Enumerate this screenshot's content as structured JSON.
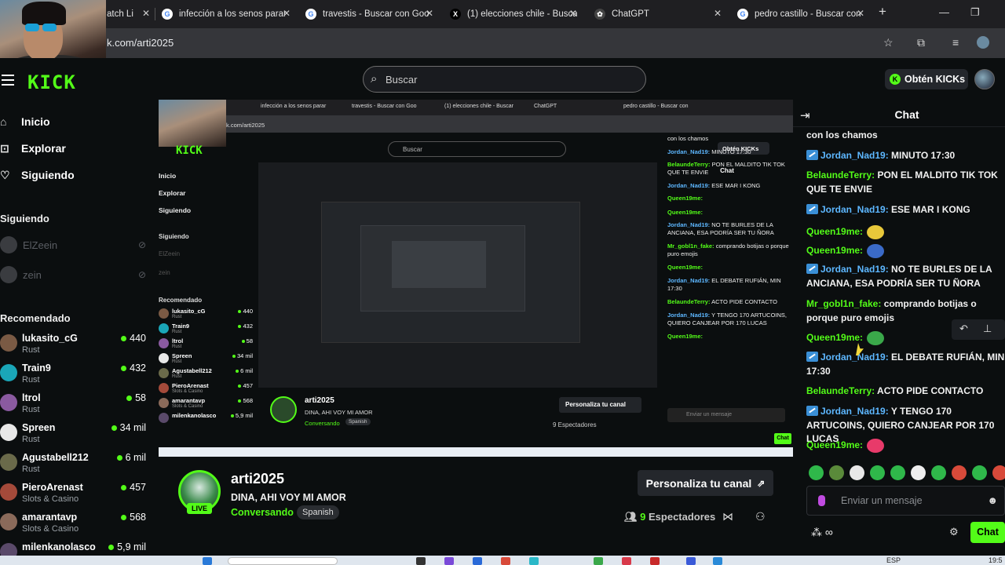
{
  "browser": {
    "tabs": [
      {
        "label": "atch Li",
        "icon": "twitch-icon"
      },
      {
        "label": "infección a los senos parar",
        "icon": "google-icon"
      },
      {
        "label": "travestis - Buscar con Goo",
        "icon": "google-icon"
      },
      {
        "label": "(1) elecciones chile - Buscar",
        "icon": "x-icon"
      },
      {
        "label": "ChatGPT",
        "icon": "chatgpt-icon"
      },
      {
        "label": "pedro castillo - Buscar con",
        "icon": "google-icon"
      }
    ],
    "url": "k.com/arti2025"
  },
  "header": {
    "logo": "KICK",
    "search_placeholder": "Buscar",
    "kicks_button": "Obtén KICKs"
  },
  "sidebar": {
    "nav": [
      {
        "label": "Inicio",
        "icon": "home-icon"
      },
      {
        "label": "Explorar",
        "icon": "compass-icon"
      },
      {
        "label": "Siguiendo",
        "icon": "heart-icon"
      }
    ],
    "following_title": "Siguiendo",
    "following": [
      {
        "name": "ElZeein"
      },
      {
        "name": "zein"
      }
    ],
    "recommended_title": "Recomendado",
    "recommended": [
      {
        "name": "lukasito_cG",
        "category": "Rust",
        "viewers": "440",
        "color": "#7a5a44"
      },
      {
        "name": "Train9",
        "category": "Rust",
        "viewers": "432",
        "color": "#1aa6b8"
      },
      {
        "name": "ltrol",
        "category": "Rust",
        "viewers": "58",
        "color": "#8a5aa0"
      },
      {
        "name": "Spreen",
        "category": "Rust",
        "viewers": "34 mil",
        "color": "#e8e8e8"
      },
      {
        "name": "Agustabell212",
        "category": "Rust",
        "viewers": "6 mil",
        "color": "#6a6a4a"
      },
      {
        "name": "PieroArenast",
        "category": "Slots & Casino",
        "viewers": "457",
        "color": "#a44a3a"
      },
      {
        "name": "amarantavp",
        "category": "Slots & Casino",
        "viewers": "568",
        "color": "#8a6a5a"
      },
      {
        "name": "milenkanolasco",
        "category": "",
        "viewers": "5,9 mil",
        "color": "#5a4a6a"
      }
    ]
  },
  "video_inner": {
    "url": "k.com/arti2025",
    "search_placeholder": "Buscar",
    "kicks_button": "Obtén KICKs",
    "nav": [
      "Inicio",
      "Explorar",
      "Siguiendo"
    ],
    "following_title": "Siguiendo",
    "following": [
      "ElZeein",
      "zein"
    ],
    "recommended_title": "Recomendado",
    "recommended": [
      {
        "name": "lukasito_cG",
        "category": "Rust",
        "viewers": "440"
      },
      {
        "name": "Train9",
        "category": "Rust",
        "viewers": "432"
      },
      {
        "name": "ltrol",
        "category": "Rust",
        "viewers": "58"
      },
      {
        "name": "Spreen",
        "category": "Rust",
        "viewers": "34 mil"
      },
      {
        "name": "Agustabell212",
        "category": "Rust",
        "viewers": "6 mil"
      },
      {
        "name": "PieroArenast",
        "category": "Slots & Casino",
        "viewers": "457"
      },
      {
        "name": "amarantavp",
        "category": "Slots & Casino",
        "viewers": "568"
      },
      {
        "name": "milenkanolasco",
        "category": "",
        "viewers": "5,9 mil"
      }
    ],
    "chat_title": "Chat",
    "chat_messages": [
      {
        "user": "",
        "text": "con los chamos"
      },
      {
        "user": "Jordan_Nad19:",
        "text": "MINUTO 17:30",
        "blue": true
      },
      {
        "user": "BelaundeTerry:",
        "text": "PON EL MALDITO TIK TOK QUE TE ENVIE"
      },
      {
        "user": "Jordan_Nad19:",
        "text": "ESE MAR I KONG",
        "blue": true
      },
      {
        "user": "Queen19me:",
        "text": ""
      },
      {
        "user": "Queen19me:",
        "text": ""
      },
      {
        "user": "Jordan_Nad19:",
        "text": "NO TE BURLES DE LA ANCIANA, ESA PODRÍA SER TU ÑORA",
        "blue": true
      },
      {
        "user": "Mr_gobl1n_fake:",
        "text": "comprando botijas o porque puro emojis"
      },
      {
        "user": "Queen19me:",
        "text": ""
      },
      {
        "user": "Jordan_Nad19:",
        "text": "EL DEBATE RUFIÁN, MIN 17:30",
        "blue": true
      },
      {
        "user": "BelaundeTerry:",
        "text": "ACTO PIDE CONTACTO"
      },
      {
        "user": "Jordan_Nad19:",
        "text": "Y TENGO 170 ARTUCOINS, QUIERO CANJEAR POR 170 LUCAS",
        "blue": true
      },
      {
        "user": "Queen19me:",
        "text": ""
      }
    ],
    "chat_placeholder": "Enviar un mensaje",
    "chat_send": "Chat",
    "streamer": "arti2025",
    "title": "DINA, AHI VOY MI AMOR",
    "category": "Conversando",
    "tag": "Spanish",
    "personalize": "Personaliza tu canal",
    "viewers": "9 Espectadores"
  },
  "stream": {
    "streamer": "arti2025",
    "live_label": "LIVE",
    "title": "DINA, AHI VOY MI AMOR",
    "category": "Conversando",
    "tag": "Spanish",
    "personalize": "Personaliza tu canal",
    "viewer_count": "9",
    "viewer_label": "Espectadores"
  },
  "chat": {
    "title": "Chat",
    "messages": [
      {
        "user": "",
        "text": "con los chamos",
        "blue": false,
        "badge": false
      },
      {
        "user": "Jordan_Nad19:",
        "text": "MINUTO 17:30",
        "blue": true,
        "badge": true
      },
      {
        "user": "BelaundeTerry:",
        "text": "PON EL MALDITO TIK TOK QUE TE ENVIE",
        "blue": false,
        "badge": false
      },
      {
        "user": "Jordan_Nad19:",
        "text": "ESE MAR I KONG",
        "blue": true,
        "badge": true
      },
      {
        "user": "Queen19me:",
        "text": "",
        "blue": false,
        "badge": false,
        "emote": "#e8c83a"
      },
      {
        "user": "Queen19me:",
        "text": "",
        "blue": false,
        "badge": false,
        "emote": "#3a6ac8"
      },
      {
        "user": "Jordan_Nad19:",
        "text": "NO TE BURLES DE LA ANCIANA, ESA PODRÍA SER TU ÑORA",
        "blue": true,
        "badge": true
      },
      {
        "user": "Mr_gobl1n_fake:",
        "text": "comprando botijas o porque puro emojis",
        "blue": false,
        "badge": false
      },
      {
        "user": "Queen19me:",
        "text": "",
        "blue": false,
        "badge": false,
        "emote": "#3aa84a"
      },
      {
        "user": "Jordan_Nad19:",
        "text": "EL DEBATE RUFIÁN, MIN 17:30",
        "blue": true,
        "badge": true
      },
      {
        "user": "BelaundeTerry:",
        "text": "ACTO PIDE CONTACTO",
        "blue": false,
        "badge": false
      },
      {
        "user": "Jordan_Nad19:",
        "text": "Y TENGO 170 ARTUCOINS, QUIERO CANJEAR POR 170 LUCAS",
        "blue": true,
        "badge": true
      },
      {
        "user": "Queen19me:",
        "text": "",
        "blue": false,
        "badge": false,
        "emote": "#e83a6a"
      }
    ],
    "input_placeholder": "Enviar un mensaje",
    "send_label": "Chat"
  },
  "taskbar": {
    "lang": "ESP",
    "time": "19:5"
  },
  "colors": {
    "accent": "#53fc18",
    "bg": "#0b0e0f",
    "blue_user": "#5db7ff"
  }
}
